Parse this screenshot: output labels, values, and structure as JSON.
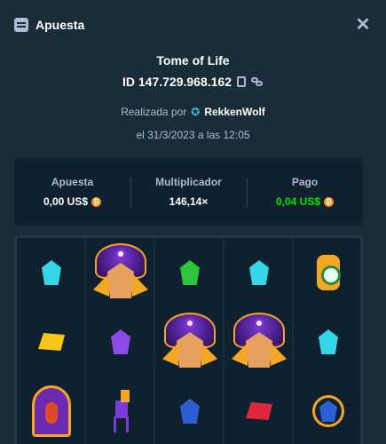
{
  "header": {
    "title": "Apuesta",
    "icon": "bet-slip-icon",
    "close_icon": "close-icon"
  },
  "game": {
    "title": "Tome of Life",
    "id_label": "ID 147.729.968.162",
    "placed_by_prefix": "Realizada por",
    "user": "RekkenWolf",
    "date": "el 31/3/2023 a las 12:05"
  },
  "stats": {
    "bet": {
      "label": "Apuesta",
      "value": "0,00 US$"
    },
    "multiplier": {
      "label": "Multiplicador",
      "value": "146,14×"
    },
    "payout": {
      "label": "Pago",
      "value": "0,04 US$"
    }
  },
  "colors": {
    "background": "#1a2c38",
    "panel": "#0f212e",
    "muted": "#b1bad3",
    "payout_green": "#00e701",
    "coin": "#f7931a"
  },
  "board": {
    "rows": [
      [
        "cyan-gem",
        "scatter-scarab",
        "green-gem",
        "cyan-gem",
        "scroll-eye"
      ],
      [
        "yellow-gem",
        "purple-gem",
        "scatter-scarab",
        "scatter-scarab",
        "cyan-gem"
      ],
      [
        "door-wild",
        "purple-dog",
        "blue-gem",
        "red-gem",
        "blue-orb"
      ]
    ]
  }
}
